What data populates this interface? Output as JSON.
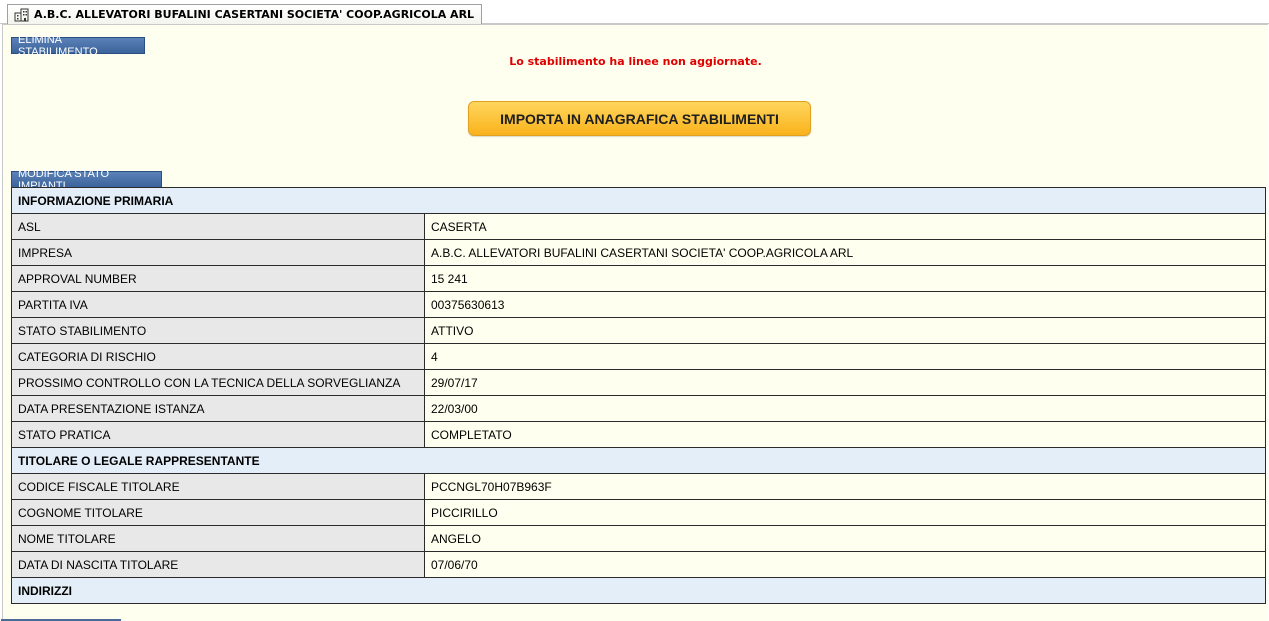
{
  "tab": {
    "title": "A.B.C. ALLEVATORI BUFALINI CASERTANI SOCIETA' COOP.AGRICOLA ARL",
    "icon": "building-icon"
  },
  "buttons": {
    "elimina": "ELIMINA STABILIMENTO",
    "importa": "IMPORTA IN ANAGRAFICA STABILIMENTI",
    "modifica": "MODIFICA STATO IMPIANTI"
  },
  "warning": "Lo stabilimento ha linee non aggiornate.",
  "sections": {
    "primaria": "INFORMAZIONE PRIMARIA",
    "titolare": "TITOLARE O LEGALE RAPPRESENTANTE",
    "indirizzi": "INDIRIZZI"
  },
  "rows": [
    {
      "label": "ASL",
      "value": "CASERTA"
    },
    {
      "label": "IMPRESA",
      "value": "A.B.C. ALLEVATORI BUFALINI CASERTANI SOCIETA' COOP.AGRICOLA ARL"
    },
    {
      "label": "APPROVAL NUMBER",
      "value": "15 241"
    },
    {
      "label": "PARTITA IVA",
      "value": "00375630613"
    },
    {
      "label": "STATO STABILIMENTO",
      "value": "ATTIVO"
    },
    {
      "label": "CATEGORIA DI RISCHIO",
      "value": "4"
    },
    {
      "label": "PROSSIMO CONTROLLO CON LA TECNICA DELLA SORVEGLIANZA",
      "value": "29/07/17"
    },
    {
      "label": "DATA PRESENTAZIONE ISTANZA",
      "value": "22/03/00"
    },
    {
      "label": "STATO PRATICA",
      "value": "COMPLETATO"
    },
    {
      "label": "CODICE FISCALE TITOLARE",
      "value": "PCCNGL70H07B963F"
    },
    {
      "label": "COGNOME TITOLARE",
      "value": "PICCIRILLO"
    },
    {
      "label": "NOME TITOLARE",
      "value": "ANGELO"
    },
    {
      "label": "DATA DI NASCITA TITOLARE",
      "value": "07/06/70"
    }
  ]
}
